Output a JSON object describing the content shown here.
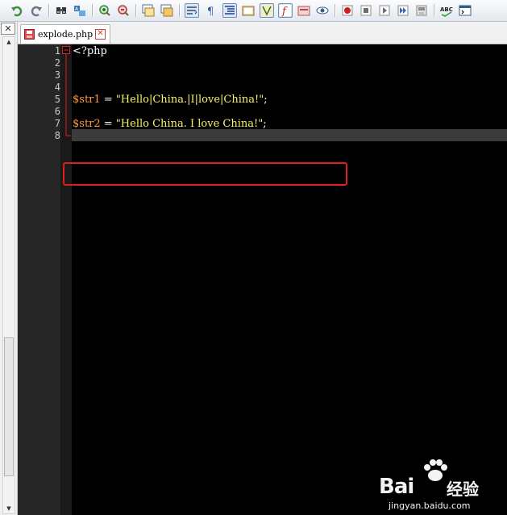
{
  "toolbar": {
    "buttons": [
      "undo-icon",
      "redo-icon",
      "find-icon",
      "replace-icon",
      "zoom-in-icon",
      "zoom-out-icon",
      "sync-vertical-icon",
      "sync-horizontal-icon",
      "word-wrap-icon",
      "show-all-chars-icon",
      "indent-guide-icon",
      "doc-map-icon",
      "function-list-icon",
      "user-language-icon",
      "folder-workspace-icon",
      "monitoring-icon",
      "record-macro-icon",
      "stop-macro-icon",
      "play-macro-icon",
      "run-macro-multiple-icon",
      "save-macro-icon",
      "spell-check-icon",
      "console-icon"
    ],
    "spell_label": "ABC"
  },
  "left_panel": {
    "close_glyph": "✕"
  },
  "tab": {
    "label": "explode.php",
    "close_glyph": "✕"
  },
  "editor": {
    "line_numbers": [
      "1",
      "2",
      "3",
      "4",
      "5",
      "6",
      "7",
      "8"
    ],
    "lines": {
      "l1": "<?php",
      "l5_var": "$str1",
      "l5_op": " = ",
      "l5_str": "\"Hello|China.|I|love|China!\"",
      "l5_end": ";",
      "l7_var": "$str2",
      "l7_op": " = ",
      "l7_str": "\"Hello China. I love China!\"",
      "l7_end": ";"
    },
    "colors": {
      "background": "#000000",
      "variable": "#ff9b3d",
      "string": "#f8f36a",
      "highlight_box": "#e31e1e",
      "fold_marker": "#e31e1e"
    }
  },
  "watermark": {
    "text": "Bai",
    "cn": "经验",
    "sub": "jingyan.baidu.com"
  }
}
